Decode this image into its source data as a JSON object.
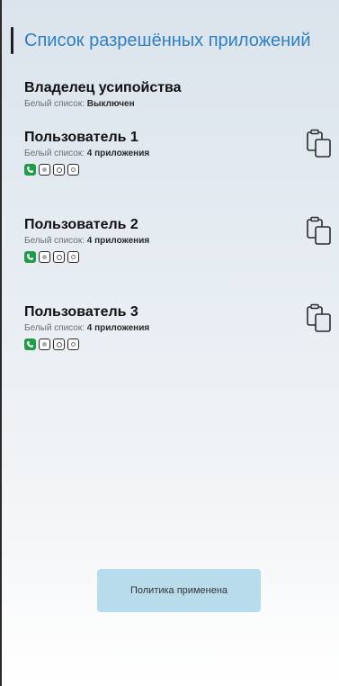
{
  "page": {
    "title": "Список разрешённых приложений"
  },
  "owner": {
    "name": "Владелец усипойства",
    "whitelist_prefix": "Белый список:",
    "whitelist_value": "Выключен"
  },
  "users": [
    {
      "name": "Пользователь 1",
      "whitelist_prefix": "Белый список:",
      "whitelist_value": "4 приложения",
      "apps": [
        "phone-icon",
        "app-square-icon",
        "app-square-icon",
        "app-square-icon"
      ]
    },
    {
      "name": "Пользователь 2",
      "whitelist_prefix": "Белый список:",
      "whitelist_value": "4 приложения",
      "apps": [
        "phone-icon",
        "app-square-icon",
        "app-square-icon",
        "app-square-icon"
      ]
    },
    {
      "name": "Пользователь 3",
      "whitelist_prefix": "Белый список:",
      "whitelist_value": "4 приложения",
      "apps": [
        "phone-icon",
        "app-square-icon",
        "app-square-icon",
        "app-square-icon"
      ]
    }
  ],
  "toast": {
    "text": "Политика применена"
  },
  "colors": {
    "title": "#2f80c6",
    "phone_app": "#1f9b4a",
    "toast_bg": "#b9dced"
  }
}
